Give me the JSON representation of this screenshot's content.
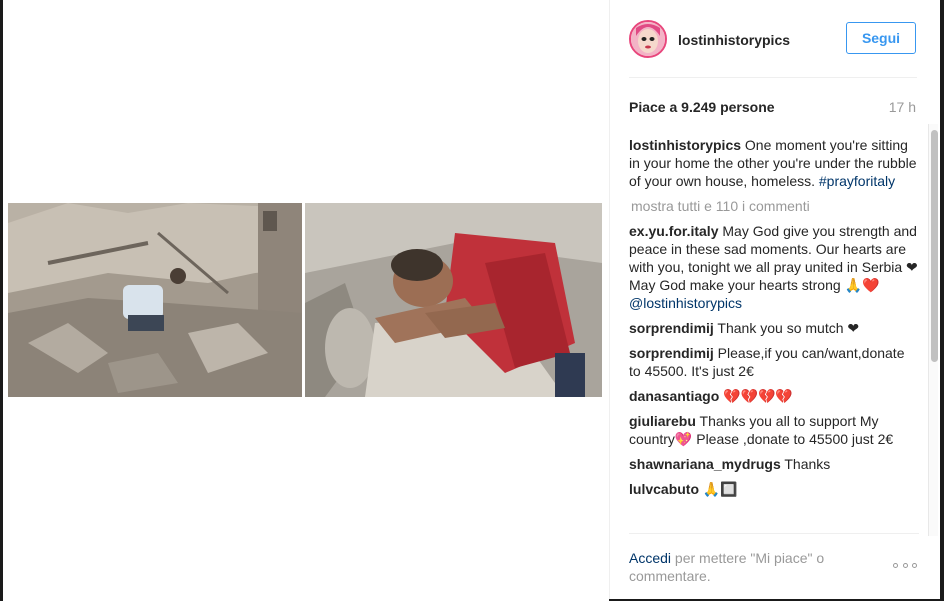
{
  "post": {
    "username": "lostinhistorypics",
    "follow_label": "Segui",
    "likes_text": "Piace a 9.249 persone",
    "time_ago": "17 h"
  },
  "caption": {
    "username": "lostinhistorypics",
    "text": " One moment you're sitting in your home the other you're under the rubble of your own house, homeless. ",
    "hashtag": "#prayforitaly"
  },
  "show_all_comments": "mostra tutti e 110 i commenti",
  "comments": [
    {
      "user": "ex.yu.for.italy",
      "text": " May God give you strength and peace in these sad moments. Our hearts are with you, tonight we all pray united in Serbia ❤ May God make your hearts strong 🙏❤️ ",
      "mention": "@lostinhistorypics"
    },
    {
      "user": "sorprendimij",
      "text": " Thank you so mutch ❤"
    },
    {
      "user": "sorprendimij",
      "text": " Please,if you can/want,donate to 45500. It's just 2€"
    },
    {
      "user": "danasantiago",
      "text": " 💔💔💔💔"
    },
    {
      "user": "giuliarebu",
      "text": " Thanks you all to support My country💖 Please ,donate to 45500 just 2€"
    },
    {
      "user": "shawnariana_mydrugs",
      "text": " Thanks"
    },
    {
      "user": "lulvcabuto",
      "text": " 🙏🔲"
    }
  ],
  "footer": {
    "login_link": "Accedi",
    "login_rest": " per mettere \"Mi piace\" o commentare."
  },
  "icons": {
    "more": "more-options-icon",
    "avatar": "profile-avatar"
  },
  "colors": {
    "accent": "#3897f0",
    "link": "#003569",
    "muted": "#999999"
  }
}
